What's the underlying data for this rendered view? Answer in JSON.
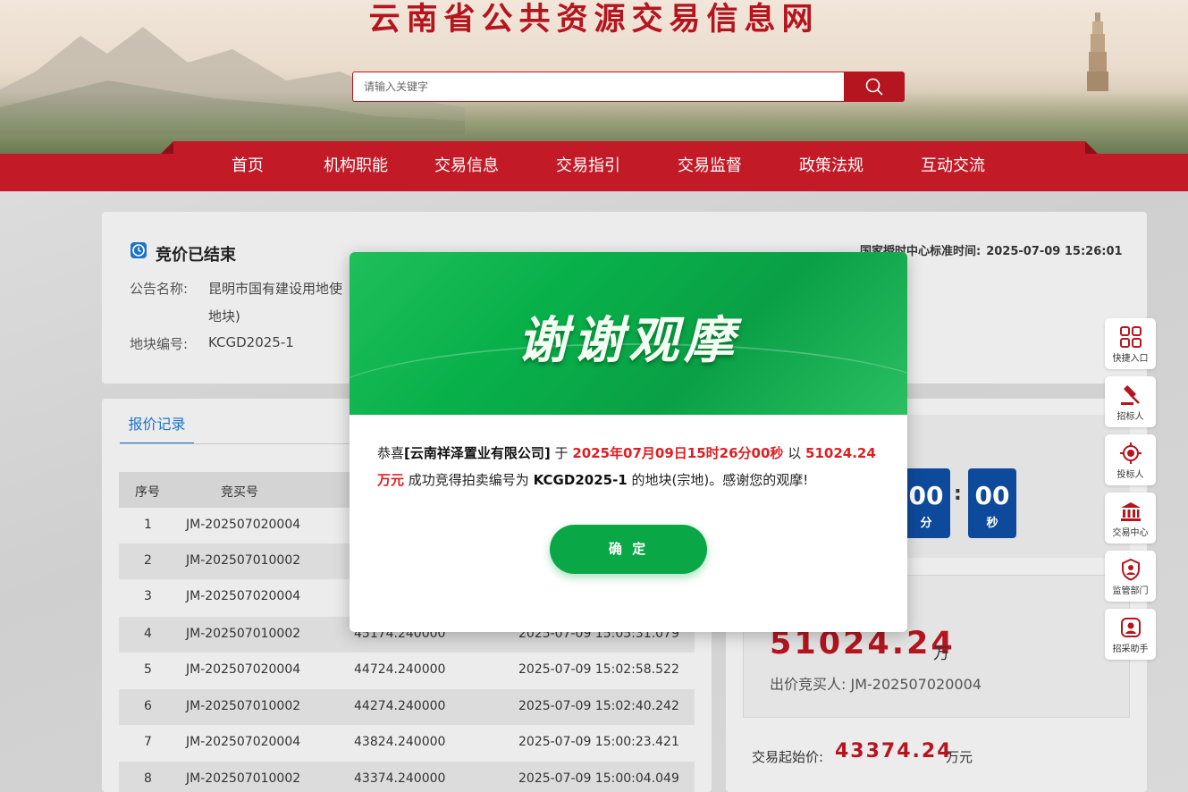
{
  "header": {
    "site_title": "云南省公共资源交易信息网",
    "search_placeholder": "请输入关键字"
  },
  "nav": {
    "items": [
      "首页",
      "机构职能",
      "交易信息",
      "交易指引",
      "交易监督",
      "政策法规",
      "互动交流"
    ]
  },
  "info": {
    "status": "竞价已结束",
    "time_label": "国家授时中心标准时间:",
    "time_value": "2025-07-09 15:26:01",
    "notice_label": "公告名称:",
    "notice_value_line1": "昆明市国有建设用地使",
    "notice_value_line2": "地块)",
    "plot_label": "地块编号:",
    "plot_value": "KCGD2025-1"
  },
  "records": {
    "tab_label": "报价记录",
    "headers": [
      "序号",
      "竞买号"
    ],
    "rows": [
      {
        "no": "1",
        "bidder": "JM-202507020004",
        "price": "",
        "time": ""
      },
      {
        "no": "2",
        "bidder": "JM-202507010002",
        "price": "",
        "time": ""
      },
      {
        "no": "3",
        "bidder": "JM-202507020004",
        "price": "",
        "time": ""
      },
      {
        "no": "4",
        "bidder": "JM-202507010002",
        "price": "45174.240000",
        "time": "2025-07-09 15:05:31.079"
      },
      {
        "no": "5",
        "bidder": "JM-202507020004",
        "price": "44724.240000",
        "time": "2025-07-09 15:02:58.522"
      },
      {
        "no": "6",
        "bidder": "JM-202507010002",
        "price": "44274.240000",
        "time": "2025-07-09 15:02:40.242"
      },
      {
        "no": "7",
        "bidder": "JM-202507020004",
        "price": "43824.240000",
        "time": "2025-07-09 15:00:23.421"
      },
      {
        "no": "8",
        "bidder": "JM-202507010002",
        "price": "43374.240000",
        "time": "2025-07-09 15:00:04.049"
      }
    ]
  },
  "countdown": {
    "minutes": "00",
    "minutes_unit": "分",
    "seconds": "00",
    "seconds_unit": "秒"
  },
  "price": {
    "current": "51024.24",
    "current_unit": "万",
    "buyer_label": "出价竞买人: JM-202507020004",
    "start_label": "交易起始价:",
    "start_value": "43374.24",
    "start_unit": "万元"
  },
  "side_toolbar": [
    {
      "label": "快捷入口",
      "icon": "grid-icon"
    },
    {
      "label": "招标人",
      "icon": "gavel-icon"
    },
    {
      "label": "投标人",
      "icon": "target-icon"
    },
    {
      "label": "交易中心",
      "icon": "bank-icon"
    },
    {
      "label": "监管部门",
      "icon": "shield-user-icon"
    },
    {
      "label": "招采助手",
      "icon": "assistant-icon"
    }
  ],
  "modal": {
    "title": "谢谢观摩",
    "msg_prefix": "恭喜",
    "company": "[云南祥泽置业有限公司]",
    "msg_at": "于",
    "datetime": "2025年07月09日15时26分00秒",
    "msg_with": "以",
    "amount": "51024.24万元",
    "msg_mid": "成功竞得拍卖编号为",
    "lot": "KCGD2025-1",
    "msg_end": "的地块(宗地)。感谢您的观摩!",
    "confirm_label": "确 定"
  },
  "colors": {
    "brand_red": "#c21b27",
    "title_red": "#b4151f",
    "modal_green": "#0aa746",
    "timer_blue": "#0e4a9b",
    "tab_blue": "#1a73c9"
  }
}
